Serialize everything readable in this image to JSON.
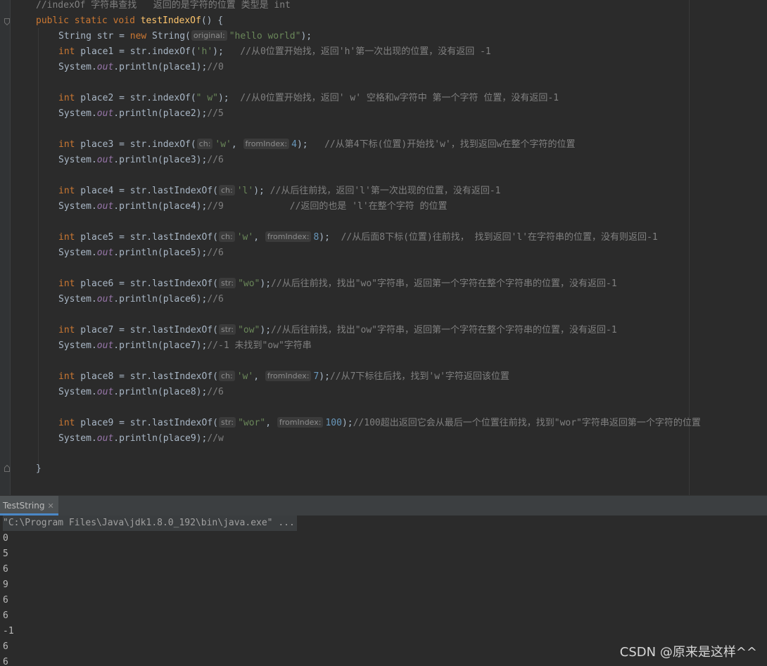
{
  "editor": {
    "comment_header": "//indexOf 字符串查找   返回的是字符的位置 类型是 int",
    "method_decl": {
      "mod_public": "public",
      "mod_static": "static",
      "mod_void": "void",
      "name": "testIndexOf",
      "tail": "() {"
    },
    "str_decl": {
      "type": "String str = ",
      "new_kw": "new",
      "ctor": " String(",
      "hint": "original:",
      "arg": "\"hello world\"",
      "tail": ");"
    },
    "close_brace": "}",
    "blocks": [
      {
        "kw": "int",
        "lhs": " place1 = str.indexOf(",
        "hint1": "",
        "arg1": "'h'",
        "hint2": "",
        "arg2": "",
        "tail": ");",
        "comment": "   //从0位置开始找，返回'h'第一次出现的位置，没有返回 -1",
        "print_pre": "System.",
        "print_fld": "out",
        "print_post": ".println(place1);",
        "print_cmt": "//0",
        "print_extra": ""
      },
      {
        "kw": "int",
        "lhs": " place2 = str.indexOf(",
        "hint1": "",
        "arg1": "\" w\"",
        "hint2": "",
        "arg2": "",
        "tail": ");",
        "comment": "  //从0位置开始找，返回' w' 空格和w字符中 第一个字符 位置，没有返回-1",
        "print_pre": "System.",
        "print_fld": "out",
        "print_post": ".println(place2);",
        "print_cmt": "//5",
        "print_extra": ""
      },
      {
        "kw": "int",
        "lhs": " place3 = str.indexOf(",
        "hint1": "ch:",
        "arg1": "'w'",
        "hint2": "fromIndex:",
        "arg2": "4",
        "tail": ");",
        "comment": "   //从第4下标(位置)开始找'w'，找到返回w在整个字符的位置",
        "print_pre": "System.",
        "print_fld": "out",
        "print_post": ".println(place3);",
        "print_cmt": "//6",
        "print_extra": ""
      },
      {
        "kw": "int",
        "lhs": " place4 = str.lastIndexOf(",
        "hint1": "ch:",
        "arg1": "'l'",
        "hint2": "",
        "arg2": "",
        "tail": ");",
        "comment": " //从后往前找，返回'l'第一次出现的位置，没有返回-1",
        "print_pre": "System.",
        "print_fld": "out",
        "print_post": ".println(place4);",
        "print_cmt": "//9",
        "print_extra": "            //返回的也是 'l'在整个字符 的位置"
      },
      {
        "kw": "int",
        "lhs": " place5 = str.lastIndexOf(",
        "hint1": "ch:",
        "arg1": "'w'",
        "hint2": "fromIndex:",
        "arg2": "8",
        "tail": ");",
        "comment": "  //从后面8下标(位置)往前找， 找到返回'l'在字符串的位置，没有则返回-1",
        "print_pre": "System.",
        "print_fld": "out",
        "print_post": ".println(place5);",
        "print_cmt": "//6",
        "print_extra": ""
      },
      {
        "kw": "int",
        "lhs": " place6 = str.lastIndexOf(",
        "hint1": "str:",
        "arg1": "\"wo\"",
        "hint2": "",
        "arg2": "",
        "tail": ");",
        "comment": "//从后往前找，找出\"wo\"字符串，返回第一个字符在整个字符串的位置，没有返回-1",
        "print_pre": "System.",
        "print_fld": "out",
        "print_post": ".println(place6);",
        "print_cmt": "//6",
        "print_extra": ""
      },
      {
        "kw": "int",
        "lhs": " place7 = str.lastIndexOf(",
        "hint1": "str:",
        "arg1": "\"ow\"",
        "hint2": "",
        "arg2": "",
        "tail": ");",
        "comment": "//从后往前找，找出\"ow\"字符串，返回第一个字符在整个字符串的位置，没有返回-1",
        "print_pre": "System.",
        "print_fld": "out",
        "print_post": ".println(place7);",
        "print_cmt": "//-1 未找到\"ow\"字符串",
        "print_extra": ""
      },
      {
        "kw": "int",
        "lhs": " place8 = str.lastIndexOf(",
        "hint1": "ch:",
        "arg1": "'w'",
        "hint2": "fromIndex:",
        "arg2": "7",
        "tail": ");",
        "comment": "//从7下标往后找，找到'w'字符返回该位置",
        "print_pre": "System.",
        "print_fld": "out",
        "print_post": ".println(place8);",
        "print_cmt": "//6",
        "print_extra": ""
      },
      {
        "kw": "int",
        "lhs": " place9 = str.lastIndexOf(",
        "hint1": "str:",
        "arg1": "\"wor\"",
        "hint2": "fromIndex:",
        "arg2": "100",
        "tail": ");",
        "comment": "//100超出返回它会从最后一个位置往前找，找到\"wor\"字符串返回第一个字符的位置",
        "print_pre": "System.",
        "print_fld": "out",
        "print_post": ".println(place9);",
        "print_cmt": "//w",
        "print_extra": ""
      }
    ]
  },
  "run_panel": {
    "tab_label": "TestString",
    "close_glyph": "✕",
    "command": "\"C:\\Program Files\\Java\\jdk1.8.0_192\\bin\\java.exe\" ...",
    "output": [
      "0",
      "5",
      "6",
      "9",
      "6",
      "6",
      "-1",
      "6",
      "6"
    ]
  },
  "watermark": "CSDN @原来是这样^^",
  "icons": {
    "fold_open": "fold-open-icon",
    "fold_end": "fold-end-icon"
  },
  "colors": {
    "keyword": "#cc7832",
    "method": "#ffc66d",
    "string": "#6a8759",
    "number": "#6897bb",
    "comment": "#808080",
    "field": "#9876aa",
    "text": "#a9b7c6",
    "background": "#2b2b2b"
  }
}
